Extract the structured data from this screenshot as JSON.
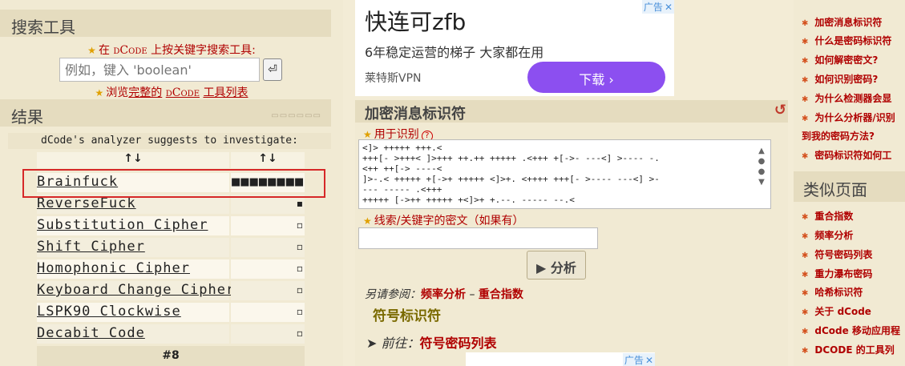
{
  "search_tools": {
    "title": "搜索工具",
    "prompt_pre": "在",
    "prompt_brand": "dCode",
    "prompt_post": "上按关键字搜索工具:",
    "input_placeholder": "例如，键入 'boolean'",
    "go_icon": "enter-icon",
    "browse_pre": "浏览",
    "browse_link": "完整的",
    "browse_brand": "dCode",
    "browse_post": "工具列表"
  },
  "results": {
    "title": "结果",
    "analyzer_text": "dCode's analyzer suggests to investigate:",
    "sort_col1": "↑↓",
    "sort_col2": "↑↓",
    "rows": [
      {
        "name": "Brainfuck",
        "score": "■■■■■■■■",
        "level": 1.0
      },
      {
        "name": "ReverseFuck",
        "score": "▪",
        "level": 0.12
      },
      {
        "name": "Substitution Cipher",
        "score": "▫",
        "level": 0.05
      },
      {
        "name": "Shift Cipher",
        "score": "▫",
        "level": 0.05
      },
      {
        "name": "Homophonic Cipher",
        "score": "▫",
        "level": 0.05
      },
      {
        "name": "Keyboard Change Cipher",
        "score": "▫",
        "level": 0.05
      },
      {
        "name": "LSPK90 Clockwise",
        "score": "▫",
        "level": 0.05
      },
      {
        "name": "Decabit Code",
        "score": "▫",
        "level": 0.05
      }
    ],
    "pager": "#8"
  },
  "ad_top": {
    "title": "快连可zfb",
    "desc": "6年稳定运营的梯子 大家都在用",
    "source": "莱特斯VPN",
    "button": "下载 ›",
    "tag": "广告",
    "close": "✕"
  },
  "identifier": {
    "title": "加密消息标识符",
    "reload_icon": "↺",
    "for_label": "用于识别",
    "help": "?",
    "cipher_text": "<]> +++++ +++.<\n+++[- >+++< ]>+++ ++.++ +++++ .<+++ +[->- ---<] >---- -.\n<++ ++[-> ----<\n]>-.< +++++ +[->+ +++++ <]>+. <++++ +++[- >---- ---<] >-\n--- ----- .<+++\n+++++ [->++ +++++ +<]>+ +.--. ----- --.<",
    "clue_label": "线索/关键字的密文（如果有）",
    "clue_value": "",
    "analyze_button": "▶ 分析",
    "see_also_label": "另请参阅：",
    "see_also_link1": "频率分析",
    "see_also_sep": " – ",
    "see_also_link2": "重合指数",
    "symbol_link": "符号标识符",
    "goto_label": "➤ 前往：",
    "goto_link": "符号密码列表"
  },
  "ad_bottom": {
    "tag": "广告",
    "close": "✕"
  },
  "sidebar": {
    "links": [
      "加密消息标识符",
      "什么是密码标识符",
      "如何解密密文?",
      "如何识别密码?",
      "为什么检测器会显",
      "为什么分析器/识别",
      "到我的密码方法?",
      "密码标识符如何工"
    ],
    "similar_title": "类似页面",
    "similar_links": [
      "重合指数",
      "频率分析",
      "符号密码列表",
      "重力瀑布密码",
      "哈希标识符",
      "关于 dCode",
      "dCode 移动应用程",
      "DCODE 的工具列"
    ]
  }
}
